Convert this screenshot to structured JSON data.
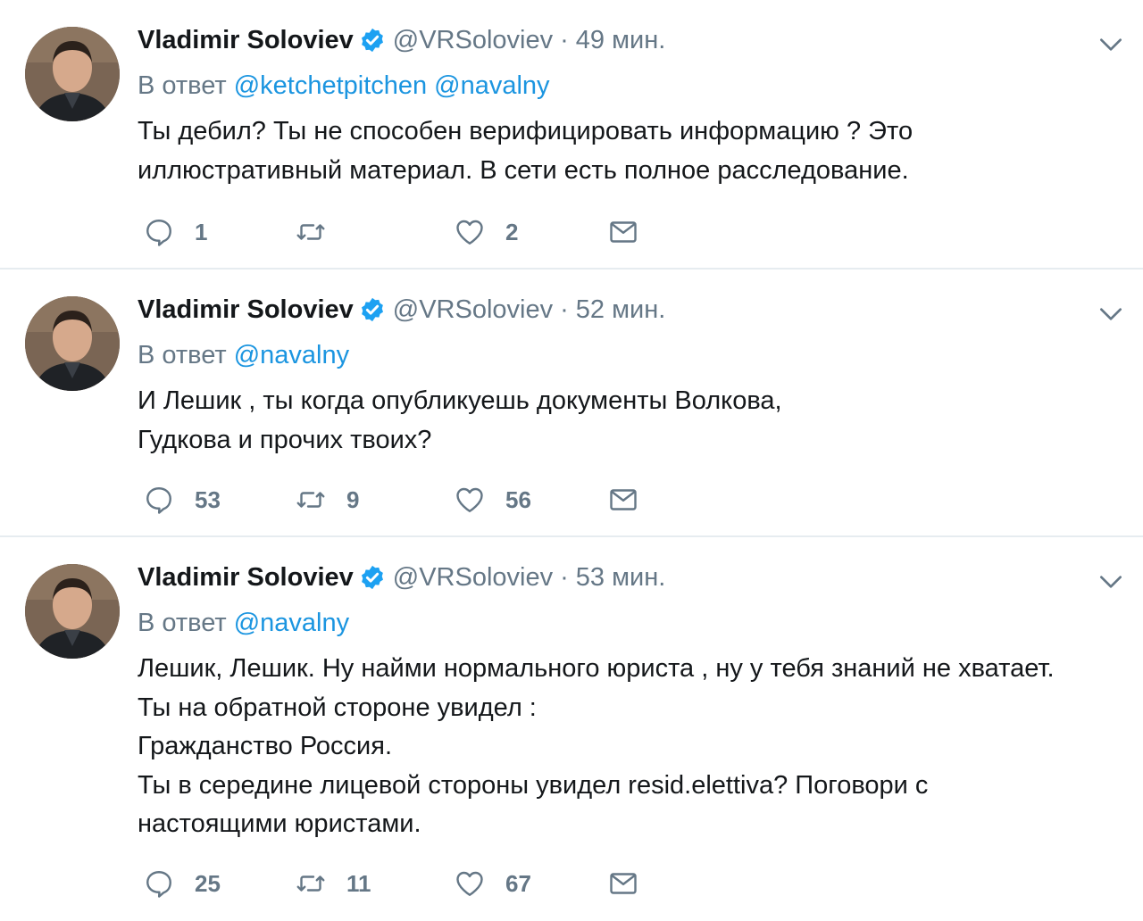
{
  "colors": {
    "accent": "#1b95e0",
    "muted": "#657786",
    "text": "#14171a",
    "verified": "#1da1f2"
  },
  "icons": {
    "reply": "reply-icon",
    "retweet": "retweet-icon",
    "like": "heart-icon",
    "dm": "envelope-icon",
    "caret": "chevron-down-icon",
    "verified": "verified-badge-icon"
  },
  "tweets": [
    {
      "name": "Vladimir Soloviev",
      "handle": "@VRSoloviev",
      "dot": "·",
      "time": "49 мин.",
      "reply_label": "В ответ",
      "mentions": [
        "@ketchetpitchen",
        "@navalny"
      ],
      "lines": [
        "Ты дебил? Ты не способен верифицировать информацию ? Это",
        "иллюстративный материал. В сети есть полное расследование."
      ],
      "replies": "1",
      "retweets": "",
      "likes": "2"
    },
    {
      "name": "Vladimir Soloviev",
      "handle": "@VRSoloviev",
      "dot": "·",
      "time": "52 мин.",
      "reply_label": "В ответ",
      "mentions": [
        "@navalny"
      ],
      "lines": [
        "И Лешик , ты когда опубликуешь документы Волкова,",
        "Гудкова и прочих твоих?"
      ],
      "replies": "53",
      "retweets": "9",
      "likes": "56"
    },
    {
      "name": "Vladimir Soloviev",
      "handle": "@VRSoloviev",
      "dot": "·",
      "time": "53 мин.",
      "reply_label": "В ответ",
      "mentions": [
        "@navalny"
      ],
      "lines": [
        "Лешик, Лешик. Ну найми нормального юриста , ну у тебя знаний не хватает.",
        "Ты на обратной стороне увидел :",
        "Гражданство Россия.",
        "Ты в середине лицевой стороны увидел resid.elettiva? Поговори с",
        "настоящими юристами."
      ],
      "replies": "25",
      "retweets": "11",
      "likes": "67"
    }
  ]
}
